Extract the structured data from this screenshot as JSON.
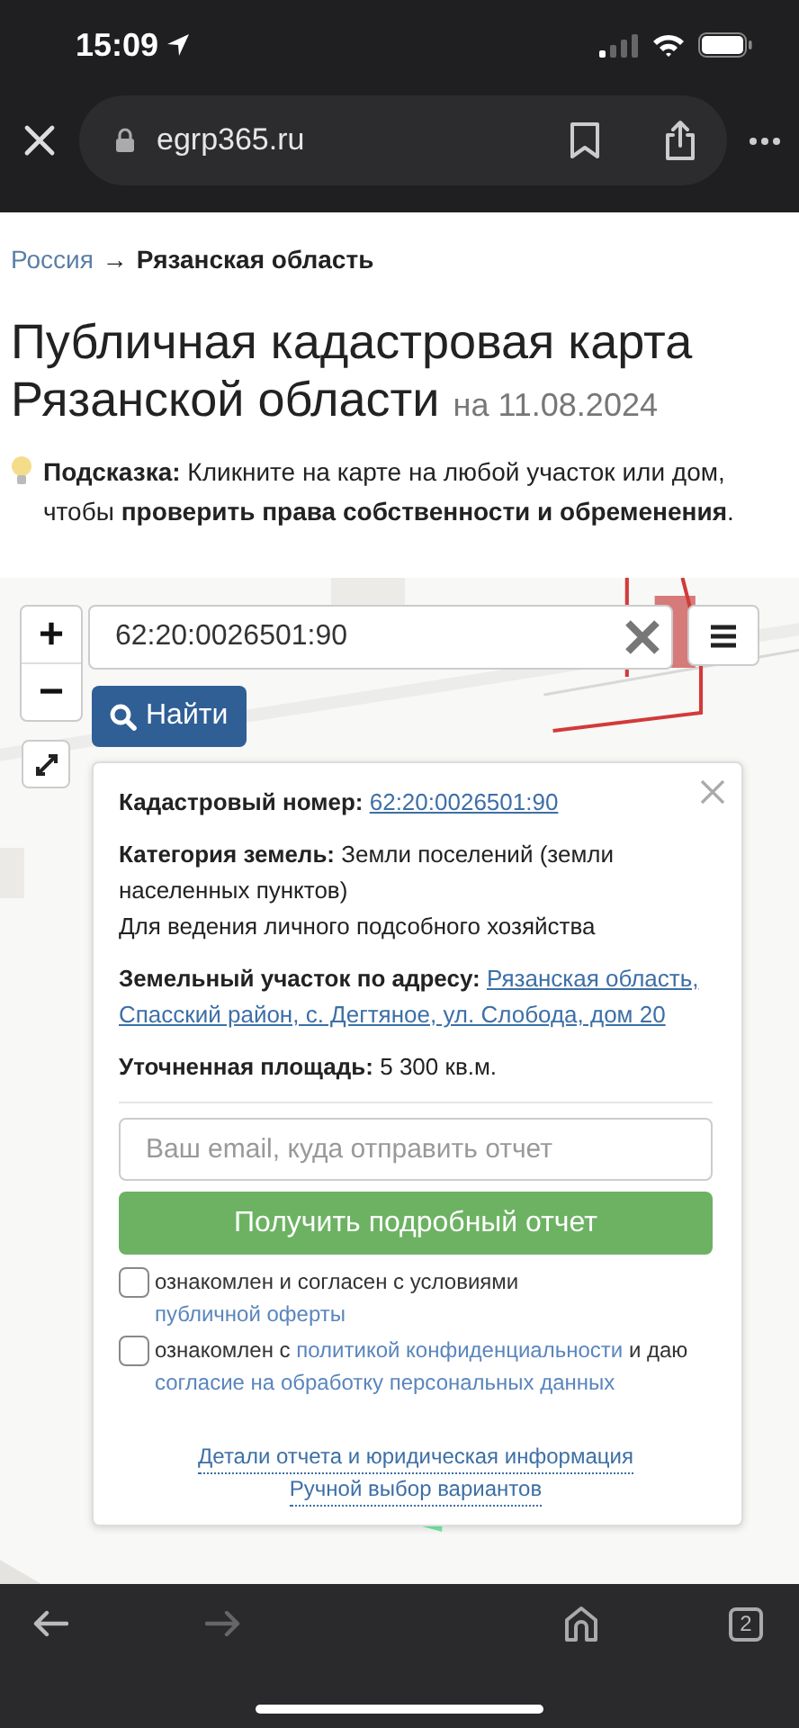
{
  "status_bar": {
    "time": "15:09"
  },
  "browser": {
    "url": "egrp365.ru"
  },
  "breadcrumb": {
    "parent": "Россия",
    "separator": "→",
    "current": "Рязанская область"
  },
  "title": {
    "text": "Публичная кадастровая карта Рязанской области",
    "date": "на 11.08.2024"
  },
  "hint": "**Подсказка:** Кликните на карте на любой участок или дом, чтобы **проверить права собственности и обременения**.",
  "map": {
    "zoom_in": "+",
    "zoom_out": "−",
    "search": {
      "value": "62:20:0026501:90"
    },
    "find_button": "Найти",
    "popup": {
      "fields": [
        {
          "label": "Кадастровый номер:",
          "kind": "link",
          "value": [
            "62:20:0026501:90"
          ]
        },
        {
          "label": "Категория земель:",
          "kind": "text",
          "value": "Земли поселений (земли населенных пунктов)",
          "note": "Для ведения личного подсобного хозяйства"
        },
        {
          "label": "Земельный участок по адресу:",
          "kind": "link",
          "value": [
            "Рязанская область,",
            "Спасский район, с. Дегтяное, ул. Слобода, дом 20"
          ]
        },
        {
          "label": "Уточненная площадь:",
          "kind": "text",
          "value": "5 300 кв.м."
        }
      ],
      "email": {
        "placeholder": "Ваш email, куда отправить отчет"
      },
      "submit": "Получить подробный отчет",
      "consents": [
        {
          "checked": false,
          "parts": [
            {
              "text": "ознакомлен и согласен с условиями ",
              "kind": "text"
            },
            {
              "text": "публичной оферты",
              "kind": "link"
            }
          ]
        },
        {
          "checked": false,
          "parts": [
            {
              "text": "ознакомлен с ",
              "kind": "text"
            },
            {
              "text": "политикой конфиденциальности",
              "kind": "link"
            },
            {
              "text": " и даю ",
              "kind": "text"
            },
            {
              "text": "согласие на обработку персональных данных",
              "kind": "link"
            }
          ]
        }
      ],
      "links": [
        "Детали отчета и юридическая информация",
        "Ручной выбор вариантов"
      ]
    }
  },
  "bottom_bar": {
    "back_enabled": true,
    "forward_enabled": false,
    "tabs_count": "2"
  }
}
